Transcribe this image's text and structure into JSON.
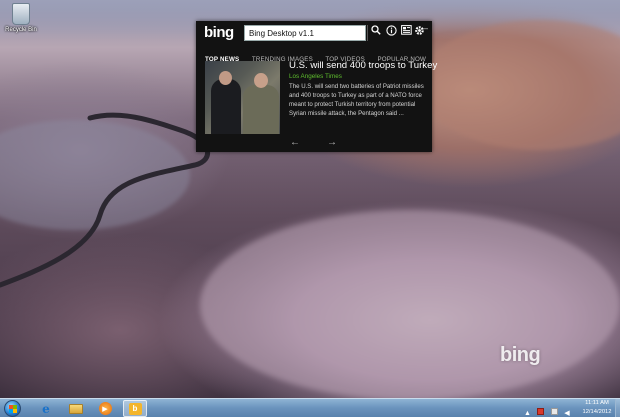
{
  "desktop": {
    "recycle_bin_label": "Recycle Bin",
    "watermark": "bing"
  },
  "bing_panel": {
    "logo": "bing",
    "search_value": "Bing Desktop v1.1",
    "minimize_glyph": "–",
    "tabs": [
      {
        "label": "TOP NEWS",
        "active": true
      },
      {
        "label": "TRENDING IMAGES",
        "active": false
      },
      {
        "label": "TOP VIDEOS",
        "active": false
      },
      {
        "label": "POPULAR NOW",
        "active": false
      }
    ],
    "news": {
      "title": "U.S. will send 400 troops to Turkey",
      "source": "Los Angeles Times",
      "body": "The U.S. will send two batteries of Patriot missiles and 400 troops to Turkey as part of a NATO force meant to protect Turkish territory from potential Syrian missile attack, the Pentagon said ..."
    },
    "icons": {
      "search": "search-icon",
      "info": "info-icon",
      "news": "news-icon",
      "settings": "gear-icon"
    },
    "prev_arrow": "←",
    "next_arrow": "→"
  },
  "taskbar": {
    "clock_time": "11:11 AM",
    "clock_date": "12/14/2012",
    "pinned": [
      "internet-explorer",
      "windows-explorer",
      "media-player",
      "bing-desktop"
    ]
  },
  "colors": {
    "panel_bg": "#121212",
    "source_green": "#5fbf2e",
    "taskbar": "#6a93bd"
  }
}
